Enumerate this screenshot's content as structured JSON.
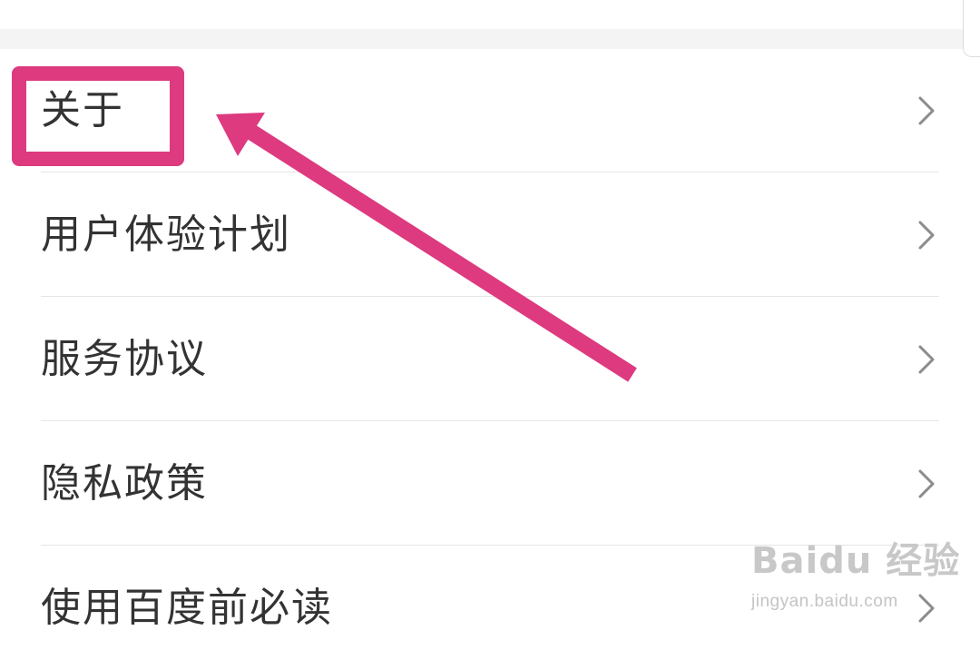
{
  "settings_menu": {
    "items": [
      {
        "label": "关于"
      },
      {
        "label": "用户体验计划"
      },
      {
        "label": "服务协议"
      },
      {
        "label": "隐私政策"
      },
      {
        "label": "使用百度前必读"
      }
    ]
  },
  "annotation": {
    "highlight_color": "#dd3a7f",
    "arrow_color": "#dd3a7f"
  },
  "watermark": {
    "logo_text": "Baidu 经验",
    "url": "jingyan.baidu.com"
  },
  "colors": {
    "text": "#333333",
    "divider": "#e6e6e6",
    "chevron": "#8c8c8c",
    "section_gap": "#f4f4f4"
  }
}
